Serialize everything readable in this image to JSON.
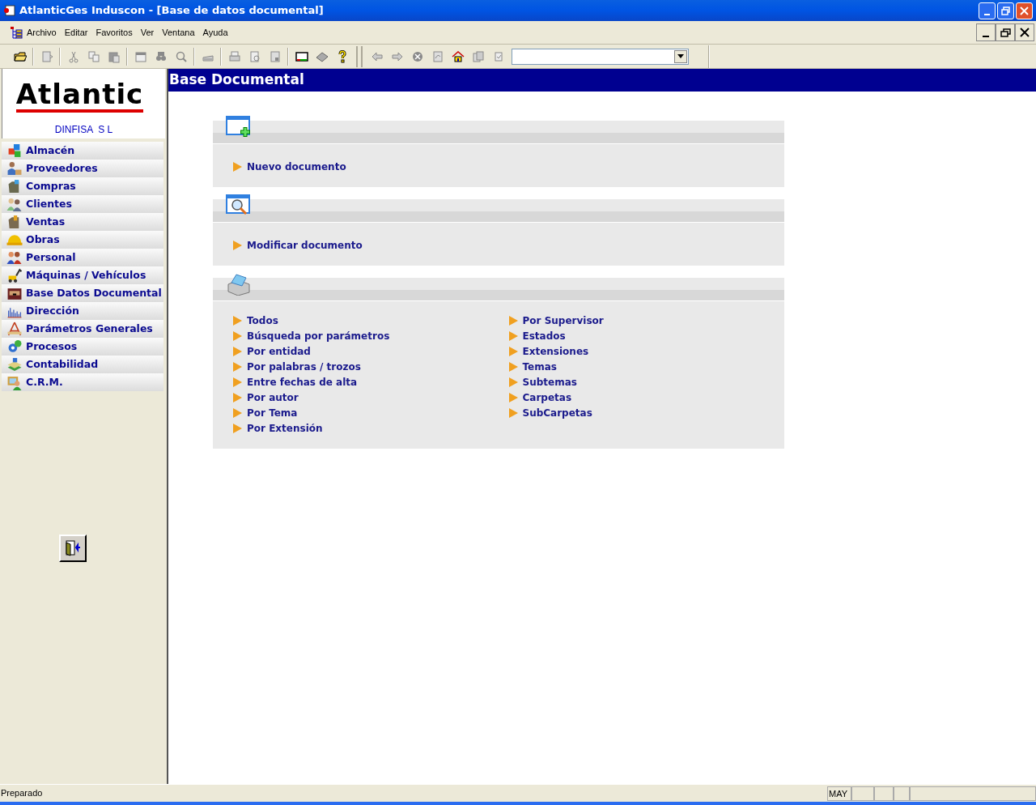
{
  "window": {
    "title": "AtlanticGes Induscon - [Base de datos documental]"
  },
  "menu": [
    "Archivo",
    "Editar",
    "Favoritos",
    "Ver",
    "Ventana",
    "Ayuda"
  ],
  "sidebar": {
    "logo": "Atlantic",
    "company": "DINFISA  S L",
    "items": [
      {
        "label": "Almacén"
      },
      {
        "label": "Proveedores"
      },
      {
        "label": "Compras"
      },
      {
        "label": "Clientes"
      },
      {
        "label": "Ventas"
      },
      {
        "label": "Obras"
      },
      {
        "label": "Personal"
      },
      {
        "label": "Máquinas / Vehículos"
      },
      {
        "label": "Base Datos Documental"
      },
      {
        "label": "Dirección"
      },
      {
        "label": "Parámetros Generales"
      },
      {
        "label": "Procesos"
      },
      {
        "label": "Contabilidad"
      },
      {
        "label": "C.R.M."
      }
    ]
  },
  "page": {
    "title": "Base Documental",
    "sections": [
      {
        "kind": "new",
        "columns": [
          [
            "Nuevo documento"
          ]
        ]
      },
      {
        "kind": "search",
        "columns": [
          [
            "Modificar documento"
          ]
        ]
      },
      {
        "kind": "print",
        "columns": [
          [
            "Todos",
            "Búsqueda por parámetros",
            "Por entidad",
            "Por palabras / trozos",
            "Entre fechas de alta",
            "Por autor",
            "Por Tema",
            "Por Extensión"
          ],
          [
            "Por Supervisor",
            "Estados",
            "Extensiones",
            "Temas",
            "Subtemas",
            "Carpetas",
            "SubCarpetas"
          ]
        ]
      }
    ]
  },
  "status_bar": {
    "message": "Preparado",
    "indicator": "MAY"
  }
}
